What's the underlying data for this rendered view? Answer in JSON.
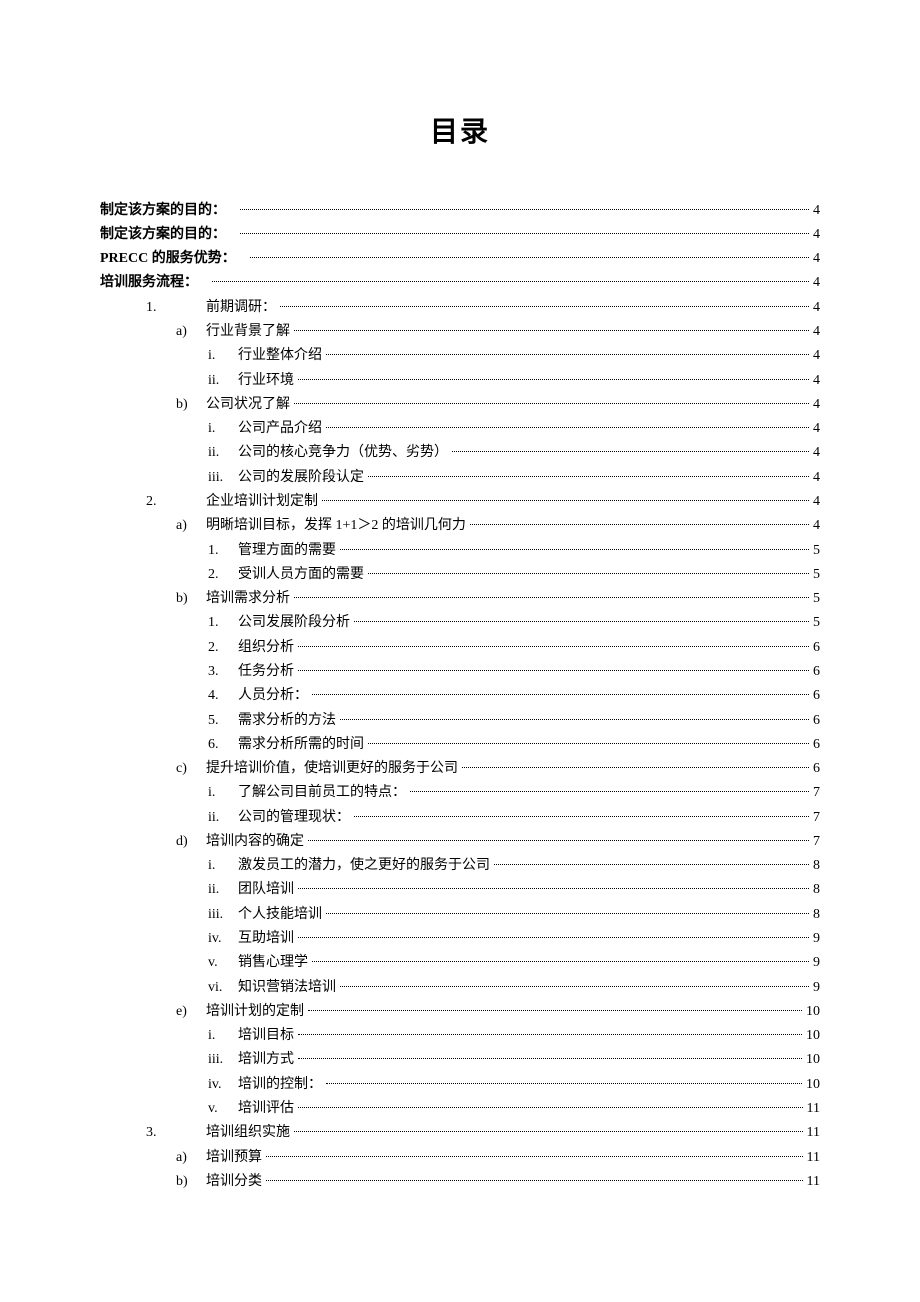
{
  "title": "目录",
  "entries": [
    {
      "indent": 0,
      "marker": "",
      "text": "制定该方案的目的：",
      "page": "4",
      "bold": true
    },
    {
      "indent": 0,
      "marker": "",
      "text": "制定该方案的目的：",
      "page": "4",
      "bold": true
    },
    {
      "indent": 0,
      "marker": "",
      "text": "PRECC 的服务优势：",
      "page": "4",
      "bold": true
    },
    {
      "indent": 0,
      "marker": "",
      "text": "培训服务流程：",
      "page": "4",
      "bold": true
    },
    {
      "indent": 1,
      "marker": "1.",
      "text": "前期调研：",
      "page": "4"
    },
    {
      "indent": 2,
      "marker": "a)",
      "text": "行业背景了解",
      "page": "4"
    },
    {
      "indent": 3,
      "marker": "i.",
      "text": "行业整体介绍",
      "page": "4"
    },
    {
      "indent": 3,
      "marker": "ii.",
      "text": "行业环境",
      "page": "4"
    },
    {
      "indent": 2,
      "marker": "b)",
      "text": "公司状况了解",
      "page": "4"
    },
    {
      "indent": 3,
      "marker": "i.",
      "text": "公司产品介绍",
      "page": "4"
    },
    {
      "indent": 3,
      "marker": "ii.",
      "text": "公司的核心竞争力（优势、劣势）",
      "page": "4"
    },
    {
      "indent": 3,
      "marker": "iii.",
      "text": "公司的发展阶段认定",
      "page": "4"
    },
    {
      "indent": 1,
      "marker": "2.",
      "text": "企业培训计划定制",
      "page": "4"
    },
    {
      "indent": 2,
      "marker": "a)",
      "text": "明晰培训目标，发挥 1+1＞2 的培训几何力",
      "page": "4"
    },
    {
      "indent": 3,
      "marker": "1.",
      "text": "管理方面的需要",
      "page": "5"
    },
    {
      "indent": 3,
      "marker": "2.",
      "text": "受训人员方面的需要",
      "page": "5"
    },
    {
      "indent": 2,
      "marker": "b)",
      "text": "培训需求分析",
      "page": "5"
    },
    {
      "indent": 3,
      "marker": "1.",
      "text": "公司发展阶段分析",
      "page": "5"
    },
    {
      "indent": 3,
      "marker": "2.",
      "text": "组织分析",
      "page": "6"
    },
    {
      "indent": 3,
      "marker": "3.",
      "text": "任务分析",
      "page": "6"
    },
    {
      "indent": 3,
      "marker": "4.",
      "text": "人员分析：",
      "page": "6"
    },
    {
      "indent": 3,
      "marker": "5.",
      "text": "需求分析的方法",
      "page": "6"
    },
    {
      "indent": 3,
      "marker": "6.",
      "text": "需求分析所需的时间",
      "page": "6"
    },
    {
      "indent": 2,
      "marker": "c)",
      "text": "提升培训价值，使培训更好的服务于公司",
      "page": "6"
    },
    {
      "indent": 3,
      "marker": "i.",
      "text": "了解公司目前员工的特点：",
      "page": "7"
    },
    {
      "indent": 3,
      "marker": "ii.",
      "text": "公司的管理现状：",
      "page": "7"
    },
    {
      "indent": 2,
      "marker": "d)",
      "text": "培训内容的确定",
      "page": "7"
    },
    {
      "indent": 3,
      "marker": "i.",
      "text": "激发员工的潜力，使之更好的服务于公司",
      "page": "8"
    },
    {
      "indent": 3,
      "marker": "ii.",
      "text": "团队培训",
      "page": "8"
    },
    {
      "indent": 3,
      "marker": "iii.",
      "text": "个人技能培训",
      "page": "8"
    },
    {
      "indent": 3,
      "marker": "iv.",
      "text": "互助培训",
      "page": "9"
    },
    {
      "indent": 3,
      "marker": "v.",
      "text": "销售心理学",
      "page": "9"
    },
    {
      "indent": 3,
      "marker": "vi.",
      "text": "知识营销法培训",
      "page": "9"
    },
    {
      "indent": 2,
      "marker": "e)",
      "text": "培训计划的定制",
      "page": "10"
    },
    {
      "indent": 3,
      "marker": "i.",
      "text": "培训目标",
      "page": "10"
    },
    {
      "indent": 3,
      "marker": "iii.",
      "text": "培训方式",
      "page": "10"
    },
    {
      "indent": 3,
      "marker": "iv.",
      "text": "培训的控制：",
      "page": "10"
    },
    {
      "indent": 3,
      "marker": "v.",
      "text": "培训评估",
      "page": "11"
    },
    {
      "indent": 1,
      "marker": "3.",
      "text": "培训组织实施",
      "page": "11"
    },
    {
      "indent": 2,
      "marker": "a)",
      "text": "培训预算",
      "page": "11"
    },
    {
      "indent": 2,
      "marker": "b)",
      "text": "培训分类",
      "page": "11"
    }
  ]
}
